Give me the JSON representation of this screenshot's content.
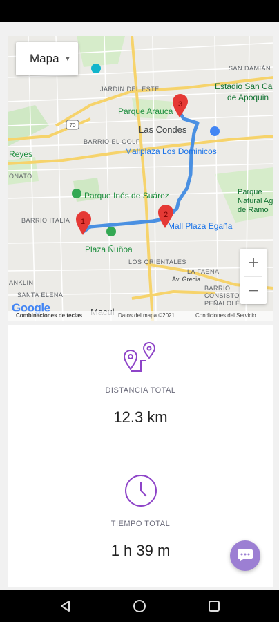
{
  "map": {
    "type_control": "Mapa",
    "zoom_in": "+",
    "zoom_out": "−",
    "google_logo": "Google",
    "attribution": {
      "shortcuts": "Combinaciones de teclas",
      "data": "Datos del mapa ©2021",
      "terms": "Condiciones del Servicio"
    },
    "markers": [
      "1",
      "2",
      "3"
    ],
    "labels": {
      "jardin_del_este": "JARDÍN DEL ESTE",
      "san_damian": "SAN DAMIÁN",
      "estadio": "Estadio San Car",
      "apoquindo": "de Apoquin",
      "parque_araucano": "Parque Arauca",
      "las_condes": "Las Condes",
      "mallplaza_dominicos": "Mallplaza Los Dominicos",
      "barrio_el_golf": "BARRIO EL GOLF",
      "reyes": "Reyes",
      "parque_ines": "Parque Inés de Suárez",
      "onato": "ONATO",
      "parque_natural": "Parque Natural Ag de Ramo",
      "barrio_italia": "BARRIO ITALIA",
      "mall_plaza_egana": "Mall Plaza Egaña",
      "plaza_nunoa": "Plaza Ñuñoa",
      "los_orientales": "LOS ORIENTALES",
      "la_faena": "LA FAENA",
      "av_grecia": "Av. Grecia",
      "franklin": "ANKLIN",
      "santa_elena": "SANTA ELENA",
      "barrio_consistorial": "BARRIO CONSISTORIAL DE PEÑALOLÉ",
      "macul": "Macul",
      "route_70": "70"
    }
  },
  "summary": {
    "distance_label": "DISTANCIA TOTAL",
    "distance_value": "12.3 km",
    "time_label": "TIEMPO TOTAL",
    "time_value": "1 h 39 m"
  },
  "colors": {
    "accent": "#8e44c8",
    "route": "#4a90e2",
    "marker": "#e53935",
    "fab": "#9c7fd3"
  }
}
